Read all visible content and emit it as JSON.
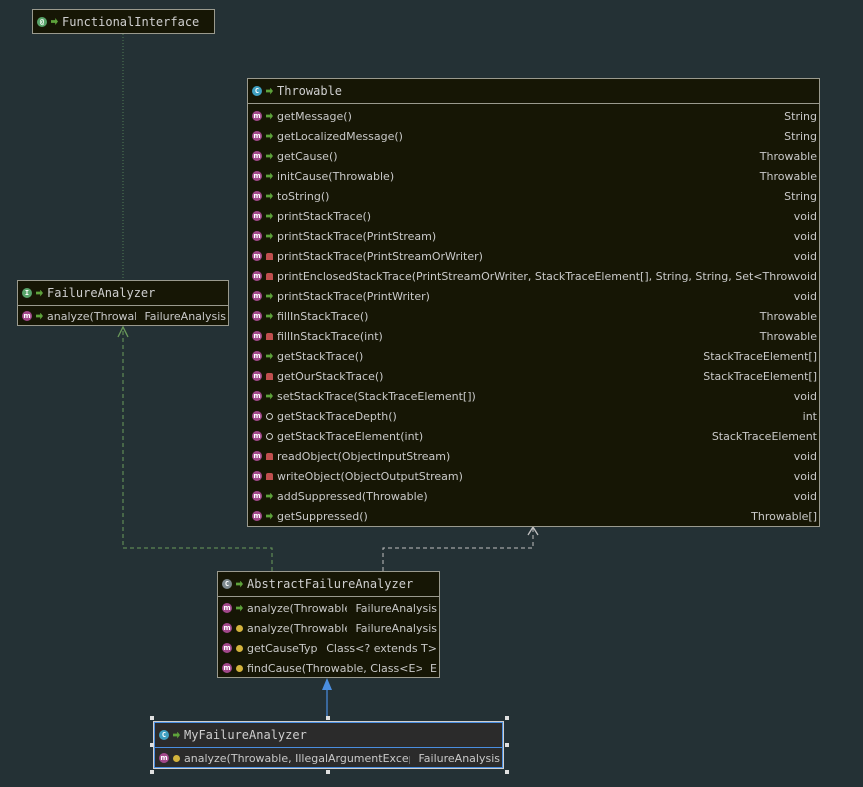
{
  "functional_interface": {
    "title": "FunctionalInterface"
  },
  "throwable": {
    "title": "Throwable",
    "methods": [
      {
        "name": "getMessage()",
        "ret": "String",
        "vis": "pub"
      },
      {
        "name": "getLocalizedMessage()",
        "ret": "String",
        "vis": "pub"
      },
      {
        "name": "getCause()",
        "ret": "Throwable",
        "vis": "pub"
      },
      {
        "name": "initCause(Throwable)",
        "ret": "Throwable",
        "vis": "pub"
      },
      {
        "name": "toString()",
        "ret": "String",
        "vis": "pub"
      },
      {
        "name": "printStackTrace()",
        "ret": "void",
        "vis": "pub"
      },
      {
        "name": "printStackTrace(PrintStream)",
        "ret": "void",
        "vis": "pub"
      },
      {
        "name": "printStackTrace(PrintStreamOrWriter)",
        "ret": "void",
        "vis": "priv"
      },
      {
        "name": "printEnclosedStackTrace(PrintStreamOrWriter, StackTraceElement[], String, String, Set<Throwable>",
        "ret": "void",
        "vis": "priv"
      },
      {
        "name": "printStackTrace(PrintWriter)",
        "ret": "void",
        "vis": "pub"
      },
      {
        "name": "fillInStackTrace()",
        "ret": "Throwable",
        "vis": "pub"
      },
      {
        "name": "fillInStackTrace(int)",
        "ret": "Throwable",
        "vis": "priv"
      },
      {
        "name": "getStackTrace()",
        "ret": "StackTraceElement[]",
        "vis": "pub"
      },
      {
        "name": "getOurStackTrace()",
        "ret": "StackTraceElement[]",
        "vis": "priv"
      },
      {
        "name": "setStackTrace(StackTraceElement[])",
        "ret": "void",
        "vis": "pub"
      },
      {
        "name": "getStackTraceDepth()",
        "ret": "int",
        "vis": "pkg"
      },
      {
        "name": "getStackTraceElement(int)",
        "ret": "StackTraceElement",
        "vis": "pkg"
      },
      {
        "name": "readObject(ObjectInputStream)",
        "ret": "void",
        "vis": "priv"
      },
      {
        "name": "writeObject(ObjectOutputStream)",
        "ret": "void",
        "vis": "priv"
      },
      {
        "name": "addSuppressed(Throwable)",
        "ret": "void",
        "vis": "pub"
      },
      {
        "name": "getSuppressed()",
        "ret": "Throwable[]",
        "vis": "pub"
      }
    ]
  },
  "failure_analyzer": {
    "title": "FailureAnalyzer",
    "methods": [
      {
        "name": "analyze(Throwable)",
        "ret": "FailureAnalysis",
        "vis": "pub"
      }
    ]
  },
  "abstract_failure_analyzer": {
    "title": "AbstractFailureAnalyzer",
    "methods": [
      {
        "name": "analyze(Throwable)",
        "ret": "FailureAnalysis",
        "vis": "pub"
      },
      {
        "name": "analyze(Throwable, T)",
        "ret": "FailureAnalysis",
        "vis": "prot"
      },
      {
        "name": "getCauseType()",
        "ret": "Class<? extends T>",
        "vis": "prot"
      },
      {
        "name": "findCause(Throwable, Class<E>)",
        "ret": "E",
        "vis": "prot"
      }
    ]
  },
  "my_failure_analyzer": {
    "title": "MyFailureAnalyzer",
    "methods": [
      {
        "name": "analyze(Throwable, IllegalArgumentException",
        "ret": "FailureAnalysis",
        "vis": "prot"
      }
    ]
  },
  "colors": {
    "background": "#243135",
    "box": "#161605",
    "inherit_arrow": "#4a8ee0",
    "implements_line": "#6a9a5a"
  }
}
